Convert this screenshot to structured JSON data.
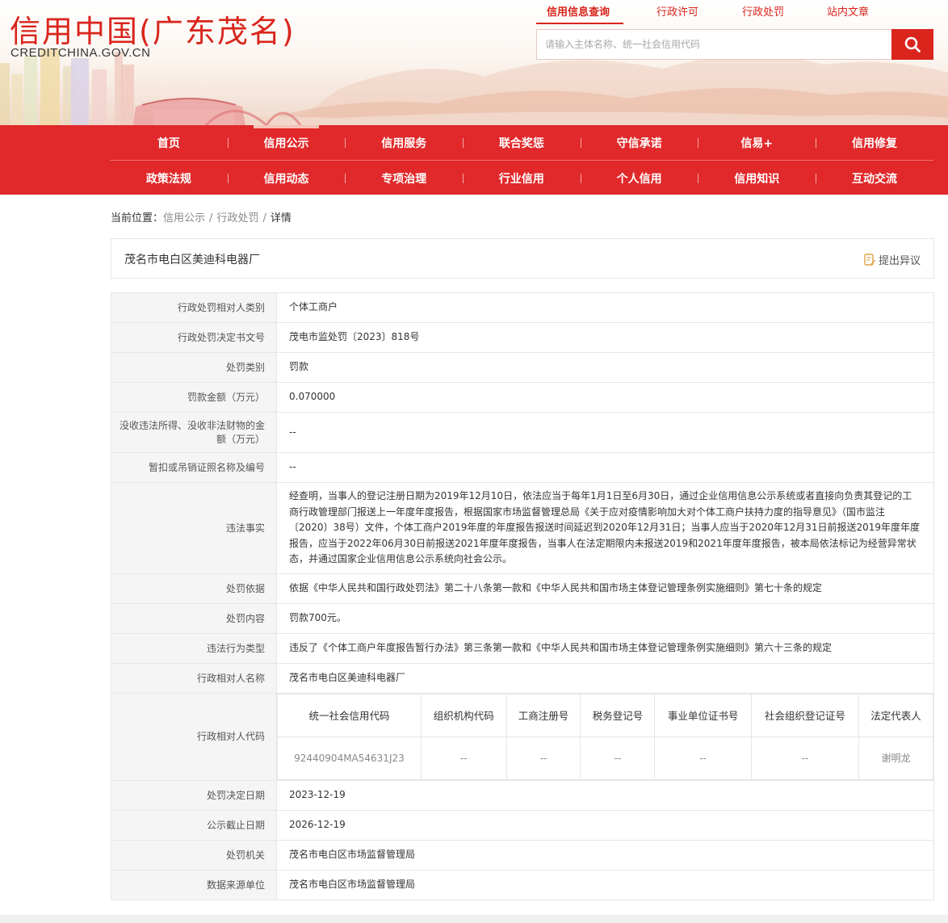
{
  "header": {
    "logo_title": "信用中国(广东茂名)",
    "logo_sub": "CREDITCHINA.GOV.CN",
    "top_links": [
      {
        "label": "信用信息查询",
        "active": true
      },
      {
        "label": "行政许可",
        "active": false
      },
      {
        "label": "行政处罚",
        "active": false
      },
      {
        "label": "站内文章",
        "active": false
      }
    ],
    "search_placeholder": "请输入主体名称、统一社会信用代码"
  },
  "nav": {
    "row1": [
      "首页",
      "信用公示",
      "信用服务",
      "联合奖惩",
      "守信承诺",
      "信易+",
      "信用修复"
    ],
    "row2": [
      "政策法规",
      "信用动态",
      "专项治理",
      "行业信用",
      "个人信用",
      "信用知识",
      "互动交流"
    ],
    "current": "信用公示"
  },
  "breadcrumb": {
    "prefix": "当前位置：",
    "items": [
      "信用公示",
      "行政处罚",
      "详情"
    ],
    "sep": "/"
  },
  "entity": {
    "name": "茂名市电白区美迪科电器厂",
    "objection_label": "提出异议"
  },
  "details": {
    "rows_top": [
      {
        "label": "行政处罚相对人类别",
        "value": "个体工商户"
      },
      {
        "label": "行政处罚决定书文号",
        "value": "茂电市监处罚〔2023〕818号"
      },
      {
        "label": "处罚类别",
        "value": "罚款"
      },
      {
        "label": "罚款金额（万元）",
        "value": "0.070000"
      },
      {
        "label": "没收违法所得、没收非法财物的金额（万元）",
        "value": "--"
      },
      {
        "label": "暂扣或吊销证照名称及编号",
        "value": "--"
      },
      {
        "label": "违法事实",
        "value": "经查明，当事人的登记注册日期为2019年12月10日，依法应当于每年1月1日至6月30日，通过企业信用信息公示系统或者直接向负责其登记的工商行政管理部门报送上一年度年度报告，根据国家市场监督管理总局《关于应对疫情影响加大对个体工商户扶持力度的指导意见》（国市监注〔2020〕38号）文件，个体工商户2019年度的年度报告报送时间延迟到2020年12月31日；当事人应当于2020年12月31日前报送2019年度年度报告，应当于2022年06月30日前报送2021年度年度报告，当事人在法定期限内未报送2019和2021年度年度报告，被本局依法标记为经营异常状态，并通过国家企业信用信息公示系统向社会公示。"
      },
      {
        "label": "处罚依据",
        "value": "依据《中华人民共和国行政处罚法》第二十八条第一款和《中华人民共和国市场主体登记管理条例实施细则》第七十条的规定"
      },
      {
        "label": "处罚内容",
        "value": "罚款700元。"
      },
      {
        "label": "违法行为类型",
        "value": "违反了《个体工商户年度报告暂行办法》第三条第一款和《中华人民共和国市场主体登记管理条例实施细则》第六十三条的规定"
      },
      {
        "label": "行政相对人名称",
        "value": "茂名市电白区美迪科电器厂"
      }
    ],
    "code_row": {
      "label": "行政相对人代码",
      "headers": [
        "统一社会信用代码",
        "组织机构代码",
        "工商注册号",
        "税务登记号",
        "事业单位证书号",
        "社会组织登记证号",
        "法定代表人"
      ],
      "values": [
        "92440904MA54631J23",
        "--",
        "--",
        "--",
        "--",
        "--",
        "谢明龙"
      ]
    },
    "rows_bottom": [
      {
        "label": "处罚决定日期",
        "value": "2023-12-19"
      },
      {
        "label": "公示截止日期",
        "value": "2026-12-19"
      },
      {
        "label": "处罚机关",
        "value": "茂名市电白区市场监督管理局"
      },
      {
        "label": "数据来源单位",
        "value": "茂名市电白区市场监督管理局"
      }
    ]
  },
  "colors": {
    "brand_red": "#d9251c",
    "nav_red": "#e1282a",
    "label_bg": "#f5f5f5",
    "border": "#e6e6e6"
  }
}
